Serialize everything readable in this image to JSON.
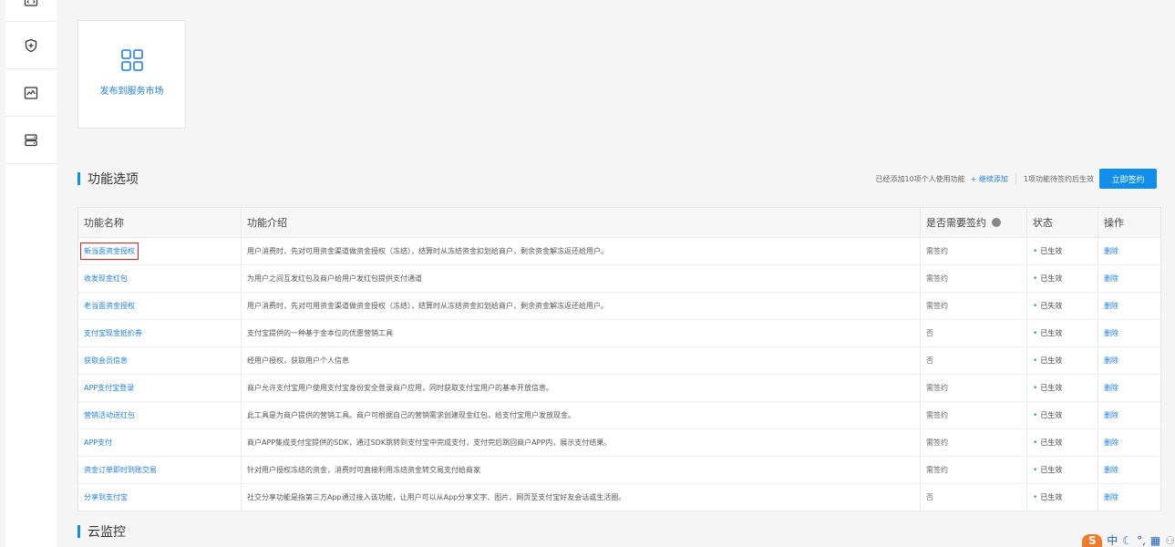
{
  "sidebar": {
    "icons": [
      "code-icon",
      "shield-plus-icon",
      "monitor-chart-icon",
      "server-icon"
    ]
  },
  "card": {
    "label": "发布到服务市场",
    "icon": "grid-icon"
  },
  "section_features": {
    "title": "功能选项"
  },
  "toolbar": {
    "added_text": "已经添加10项个人使用功能",
    "add_more": "+ 继续添加",
    "pending_text": "1项功能待签约后生效",
    "sign_button": "立即签约"
  },
  "table": {
    "headers": {
      "name": "功能名称",
      "desc": "功能介绍",
      "sign": "是否需要签约",
      "status": "状态",
      "action": "操作"
    },
    "rows": [
      {
        "name": "新当面资金授权",
        "desc": "用户消费时，先对可用资金渠道做资金授权（冻结），结算时从冻结资金扣划给商户，剩余资金解冻返还给用户。",
        "sign": "需签约",
        "status": "已生效",
        "action": "删除"
      },
      {
        "name": "收发现金红包",
        "desc": "为用户之间互发红包及商户给用户发红包提供支付通道",
        "sign": "需签约",
        "status": "已生效",
        "action": "删除"
      },
      {
        "name": "老当面资金授权",
        "desc": "用户消费时，先对可用资金渠道做资金授权（冻结），结算时从冻结资金扣划给商户，剩余资金解冻返还给用户。",
        "sign": "需签约",
        "status": "已失效",
        "action": "删除"
      },
      {
        "name": "支付宝现金抵价券",
        "desc": "支付宝提供的一种基于金本位的优惠营销工具",
        "sign": "否",
        "status": "已生效",
        "action": "删除"
      },
      {
        "name": "获取会员信息",
        "desc": "经用户授权，获取用户个人信息",
        "sign": "否",
        "status": "已生效",
        "action": "删除"
      },
      {
        "name": "APP支付宝登录",
        "desc": "商户允许支付宝用户使用支付宝身份安全登录商户应用，同时获取支付宝用户的基本开放信息。",
        "sign": "需签约",
        "status": "已生效",
        "action": "删除"
      },
      {
        "name": "营销活动送红包",
        "desc": "此工具是为商户提供的营销工具。商户可根据自己的营销需求创建现金红包，给支付宝用户发放现金。",
        "sign": "需签约",
        "status": "已生效",
        "action": "删除"
      },
      {
        "name": "APP支付",
        "desc": "商户APP集成支付宝提供的SDK，通过SDK跳转到支付宝中完成支付，支付完后跳回商户APP内，展示支付结果。",
        "sign": "需签约",
        "status": "已生效",
        "action": "删除"
      },
      {
        "name": "资金订单即时到账交易",
        "desc": "针对用户授权冻结的资金，消费时可直接利用冻结资金转交易支付给商家",
        "sign": "需签约",
        "status": "已生效",
        "action": "删除"
      },
      {
        "name": "分享到支付宝",
        "desc": "社交分享功能是指第三方App通过接入该功能，让用户可以从App分享文字、图片、网页至支付宝好友会话或生活圈。",
        "sign": "否",
        "status": "已生效",
        "action": "删除"
      }
    ]
  },
  "section_monitor": {
    "title": "云监控"
  },
  "corner": {
    "logo": "S",
    "text": "中"
  },
  "colors": {
    "accent": "#108ee9",
    "link": "#1f7fe0",
    "ok": "#2db55d",
    "highlight": "#e02020"
  }
}
